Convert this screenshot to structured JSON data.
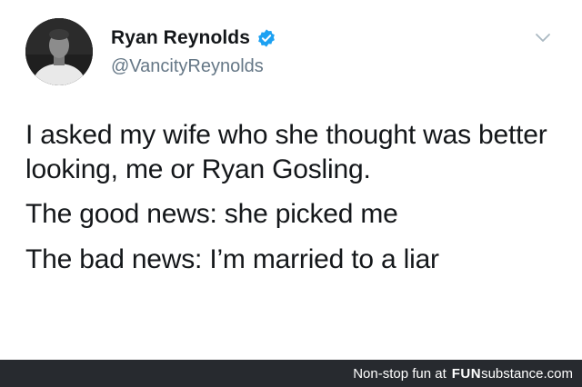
{
  "author": {
    "name": "Ryan Reynolds",
    "handle": "@VancityReynolds",
    "verified": true,
    "verified_color": "#1da1f2"
  },
  "tweet": {
    "paragraphs": [
      "I asked my wife who she thought was better looking, me or Ryan Gosling.",
      "The good news: she picked me",
      "The bad news: I’m married to a liar"
    ]
  },
  "icons": {
    "menu": "chevron-down-icon",
    "verified": "verified-badge-icon"
  },
  "footer": {
    "credit": "Non-stop fun at",
    "brand_bold": "FUN",
    "brand_rest": "substance",
    "brand_tld": ".com",
    "background": "#272a2f"
  }
}
